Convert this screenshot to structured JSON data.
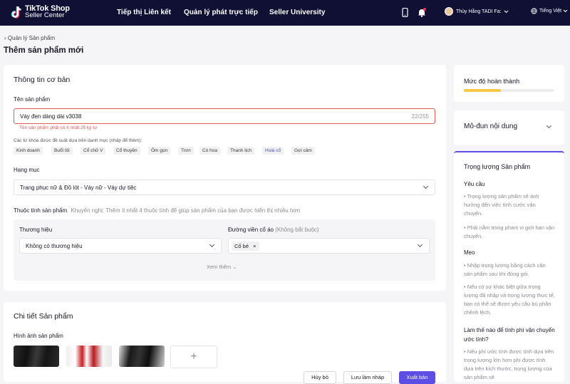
{
  "brand": {
    "line1": "TikTok Shop",
    "line2": "Seller Center"
  },
  "nav": {
    "item1": "Tiếp thị Liên kết",
    "item2": "Quản lý phát trực tiếp",
    "item3": "Seller University"
  },
  "user": {
    "name": "Thùy Hằng TADI Fa:",
    "language": "Tiếng Việt"
  },
  "breadcrumb": "Quản lý Sản phẩm",
  "page_title": "Thêm sản phẩm mới",
  "basic": {
    "title": "Thông tin cơ bản",
    "name_label": "Tên sản phẩm",
    "name_value": "Váy đen dáng dài v3038",
    "name_count": "22/255",
    "name_error": "Tên sản phẩm phải có ít nhất 25 ký tự",
    "kw_hint": "Các từ khóa được đề xuất dựa trên danh mục (nhấp để thêm):",
    "keywords": [
      "Kinh doanh",
      "Buổi tối",
      "Cổ chữ V",
      "Cổ thuyền",
      "Ôm gọn",
      "Trơn",
      "Có hoa",
      "Thanh lịch",
      "Hoài cổ",
      "Gợi cảm"
    ],
    "category_label": "Hạng mục",
    "category_value": "Trang phục nữ & Đồ lót - Váy nữ - Váy dự tiệc",
    "attr_label": "Thuộc tính sản phẩm",
    "attr_hint": "Khuyến nghị: Thêm ít nhất 4 thuộc tính để giúp sản phẩm của bạn được hiển thị nhiều hơn",
    "brand_label": "Thương hiệu",
    "brand_value": "Không có thương hiệu",
    "collar_label": "Đường viền cổ áo",
    "collar_optional": "(Không bắt buộc)",
    "collar_chip": "Cổ bẻ",
    "see_more": "Xem thêm"
  },
  "detail": {
    "title": "Chi tiết Sản phẩm",
    "images_label": "Hình ảnh sản phẩm",
    "add_symbol": "+"
  },
  "sidebar": {
    "completion_label": "Mức độ hoàn thành",
    "completion_progress": 0.41,
    "module_label": "Mô-đun nội dung",
    "weight_title": "Trọng lượng Sản phẩm",
    "req_title": "Yêu cầu",
    "req1": "• Trọng lượng sản phẩm sẽ ảnh hưởng đến việc tính cước vận chuyển.",
    "req2": "• Phải nằm trong phạm vi giới hạn vận chuyển.",
    "tips_title": "Mẹo",
    "tip1": "• Nhập trọng lượng bằng cách cân sản phẩm sau khi đóng gói.",
    "tip2": "• Nếu có sự khác biệt giữa trọng lượng đã nhập và trọng lượng thực tế, bạn có thể sẽ được yêu cầu bù phần chênh lệch.",
    "howto_title": "Làm thế nào để tính phí vận chuyển ước tính?",
    "howto1": "• Nếu phí ước tính được tính dựa trên trọng lượng lớn hơn phí được tính dựa trên kích thước, trọng lượng của sản phẩm sẽ"
  },
  "footer": {
    "cancel": "Hủy bỏ",
    "save_draft": "Lưu làm nháp",
    "publish": "Xuất bản"
  },
  "colors": {
    "topbar": "#101035",
    "accent": "#5c4ee5",
    "error": "#e05858",
    "progress": "#f7c843"
  }
}
